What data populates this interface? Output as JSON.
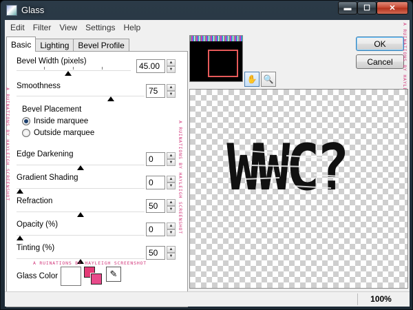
{
  "window": {
    "title": "Glass",
    "min_glyph": "▬",
    "max_glyph": "☐",
    "close_glyph": "✕"
  },
  "menu": [
    "Edit",
    "Filter",
    "View",
    "Settings",
    "Help"
  ],
  "tabs": [
    "Basic",
    "Lighting",
    "Bevel Profile"
  ],
  "settings": {
    "bevel_width": {
      "label": "Bevel Width (pixels)",
      "value": "45.00",
      "slider": 0.4
    },
    "smoothness": {
      "label": "Smoothness",
      "value": "75",
      "slider": 0.75
    },
    "bevel_placement": {
      "label": "Bevel Placement",
      "options": [
        "Inside marquee",
        "Outside marquee"
      ],
      "selected": "Inside marquee"
    },
    "edge_darkening": {
      "label": "Edge Darkening",
      "value": "0",
      "slider": 0.5
    },
    "gradient_shading": {
      "label": "Gradient Shading",
      "value": "0",
      "slider": 0.0
    },
    "refraction": {
      "label": "Refraction",
      "value": "50",
      "slider": 0.5
    },
    "opacity": {
      "label": "Opacity (%)",
      "value": "0",
      "slider": 0.0
    },
    "tinting": {
      "label": "Tinting (%)",
      "value": "50",
      "slider": 0.5
    },
    "glass_color": {
      "label": "Glass Color",
      "color": "#ffffff",
      "fg_color": "#e43a76",
      "bg_color": "#e84a8a"
    }
  },
  "buttons": {
    "ok": "OK",
    "cancel": "Cancel"
  },
  "preview": {
    "text": "WWC?"
  },
  "watermark": "A RUINATIONS BY HAYLEIGH SCREENSHOT",
  "status": {
    "zoom": "100%"
  },
  "colors": {
    "accent_pink": "#d2357a",
    "nav_rect": "#e65a5a",
    "title_bar": "#2b3a47"
  }
}
